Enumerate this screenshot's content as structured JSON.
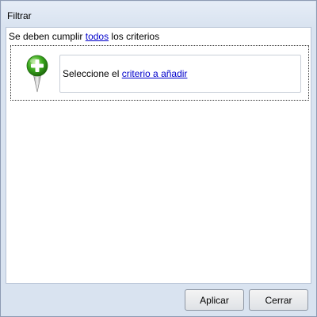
{
  "window": {
    "title": "Filtrar"
  },
  "filter": {
    "prefix": "Se deben cumplir ",
    "mode_link": "todos",
    "suffix": " los criterios"
  },
  "criterion": {
    "prefix": "Seleccione el ",
    "link": "criterio a añadir",
    "add_icon": "add-criterion-icon"
  },
  "buttons": {
    "apply": "Aplicar",
    "close": "Cerrar"
  },
  "colors": {
    "link": "#0000cc",
    "add_icon_green": "#3aa81e",
    "window_frame": "#d9e3f0"
  }
}
